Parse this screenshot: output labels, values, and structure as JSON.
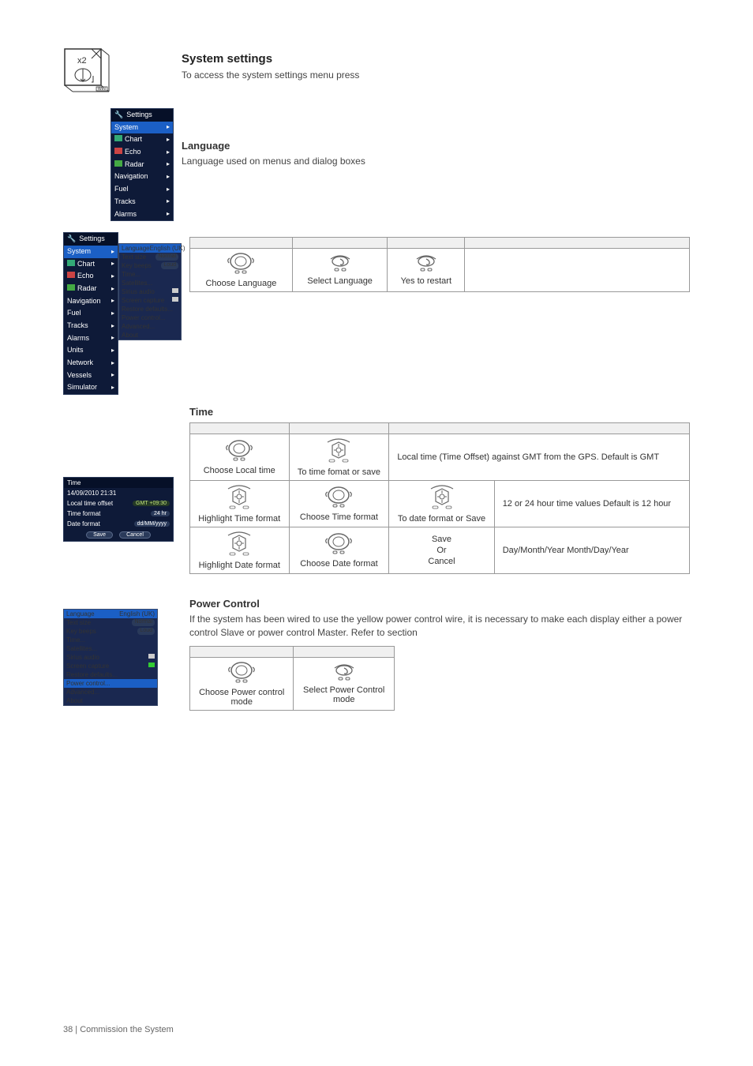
{
  "sec1": {
    "title": "System settings",
    "text": "To access the system settings menu press",
    "device_label": "x2"
  },
  "small_menu": {
    "header": "Settings",
    "items": [
      "System",
      "Chart",
      "Echo",
      "Radar",
      "Navigation",
      "Fuel",
      "Tracks",
      "Alarms"
    ]
  },
  "sec2": {
    "title": "Language",
    "text": "Language used on menus and dialog boxes"
  },
  "big_menu": {
    "header": "Settings",
    "items": [
      "System",
      "Chart",
      "Echo",
      "Radar",
      "Navigation",
      "Fuel",
      "Tracks",
      "Alarms",
      "Units",
      "Network",
      "Vessels",
      "Simulator"
    ],
    "sub_header_label": "Language",
    "sub_header_value": "English (UK)",
    "sub_items": [
      {
        "l": "Text size",
        "v": "Normal"
      },
      {
        "l": "Key beeps",
        "v": "Loud"
      },
      {
        "l": "Time...",
        "v": ""
      },
      {
        "l": "Satellites...",
        "v": ""
      },
      {
        "l": "Sirius audio",
        "v": ""
      },
      {
        "l": "Screen capture",
        "v": ""
      },
      {
        "l": "Restore defaults...",
        "v": ""
      },
      {
        "l": "Power control...",
        "v": ""
      },
      {
        "l": "Advanced...",
        "v": ""
      },
      {
        "l": "About",
        "v": ""
      }
    ]
  },
  "lang_table": {
    "r1": [
      "Choose Language",
      "Select Language",
      "Yes to restart"
    ]
  },
  "sec3": {
    "title": "Time"
  },
  "time_panel": {
    "hdr": "Time",
    "rows": [
      {
        "l": "14/09/2010 21:31",
        "v": ""
      },
      {
        "l": "Local time offset",
        "v": "GMT +09:30"
      },
      {
        "l": "Time format",
        "v": "24 hr"
      },
      {
        "l": "Date format",
        "v": "dd/MM/yyyy"
      }
    ],
    "btns": [
      "Save",
      "Cancel"
    ]
  },
  "time_table": {
    "r1": {
      "c1": "Choose Local time",
      "c2": "To time fomat or save",
      "desc": "Local time (Time Offset) against GMT from the GPS. Default is GMT"
    },
    "r2": {
      "c1": "Highlight Time format",
      "c2": "Choose Time format",
      "c3": "To date format or Save",
      "desc": "12 or 24 hour time values Default is 12 hour"
    },
    "r3": {
      "c1": "Highlight Date format",
      "c2": "Choose Date format",
      "c3_a": "Save",
      "c3_b": "Or",
      "c3_c": "Cancel",
      "desc": "Day/Month/Year Month/Day/Year"
    }
  },
  "sec4": {
    "title": "Power Control",
    "text_a": "If the system has been wired to use the yellow power control wire, it is necessary to make each display either a power control Slave or power control Master. Refer to",
    "text_b": " section"
  },
  "pc_menu": {
    "items": [
      {
        "l": "Language",
        "v": "English (UK)",
        "sel": true
      },
      {
        "l": "Text size",
        "v": "Normal"
      },
      {
        "l": "Key beeps",
        "v": "Loud"
      },
      {
        "l": "Time...",
        "v": ""
      },
      {
        "l": "Satellites...",
        "v": ""
      },
      {
        "l": "Sirius audio",
        "v": ""
      },
      {
        "l": "Screen capture",
        "v": ""
      },
      {
        "l": "Restore defaults...",
        "v": ""
      },
      {
        "l": "Power control...",
        "v": "",
        "hl": true
      },
      {
        "l": "Advanced...",
        "v": ""
      },
      {
        "l": "About",
        "v": ""
      }
    ]
  },
  "pc_table": {
    "c1": "Choose Power control mode",
    "c2": "Select Power Control mode"
  },
  "footer": "38 | Commission the System"
}
